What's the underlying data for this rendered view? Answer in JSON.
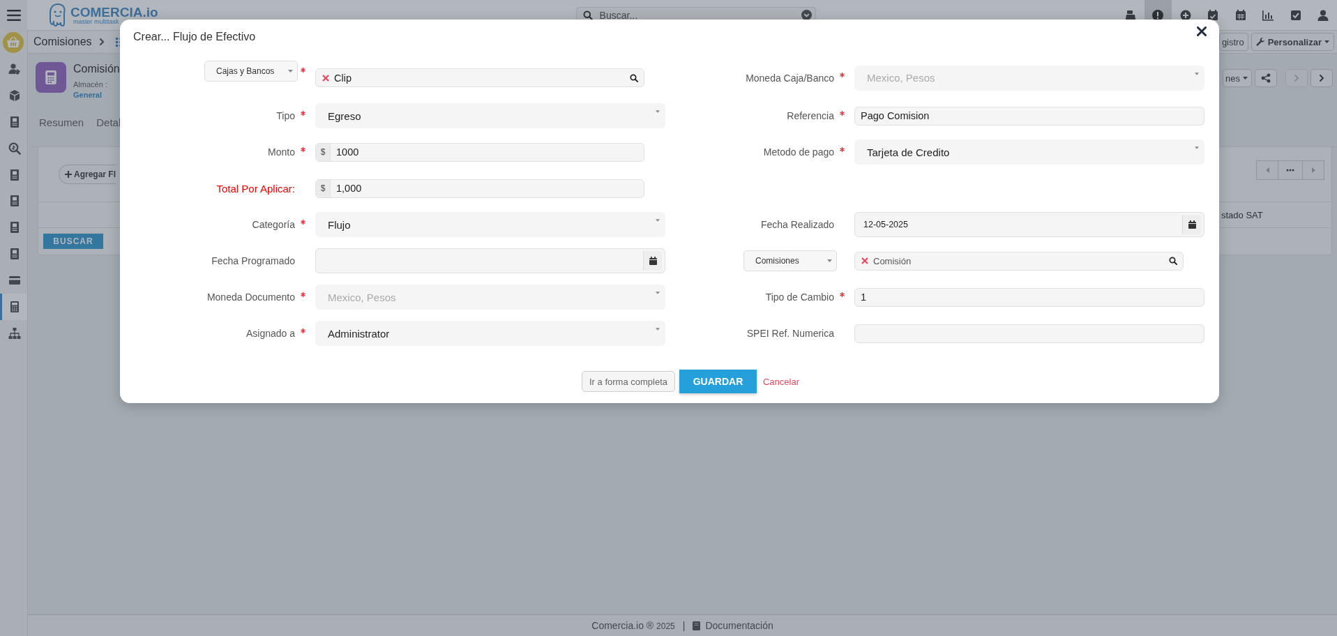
{
  "topbar": {
    "logo": {
      "name": "COMERCIA.io",
      "tagline": "master multitask"
    },
    "search": {
      "placeholder": "Buscar..."
    },
    "icons": [
      {
        "selected": false
      },
      {
        "selected": true
      },
      {
        "selected": false
      },
      {
        "selected": false
      },
      {
        "selected": false
      },
      {
        "selected": false
      },
      {
        "selected": false
      },
      {
        "selected": false
      }
    ]
  },
  "breadcrumb": {
    "current": "Comisiones"
  },
  "sidebar": {
    "items": [
      {
        "selected": false
      },
      {
        "selected": false
      },
      {
        "selected": false
      },
      {
        "selected": false
      },
      {
        "selected": false
      },
      {
        "selected": false
      },
      {
        "selected": false
      },
      {
        "selected": false
      },
      {
        "selected": false
      },
      {
        "selected": true
      },
      {
        "selected": false
      }
    ]
  },
  "record": {
    "title": "Comisión",
    "warehouse_label": "Almacén :",
    "warehouse": "General"
  },
  "header_buttons": {
    "register": "gistro",
    "customize": "Personalizar",
    "actions": "nes"
  },
  "tabs": [
    {
      "label": "Resumen",
      "selected": false
    },
    {
      "label": "Detal",
      "selected": false
    }
  ],
  "list": {
    "add_button": "Agregar Fl",
    "column": "stado SAT",
    "search_button": "BUSCAR"
  },
  "modal": {
    "title": "Crear... Flujo de Efectivo",
    "left": [
      {
        "kind": "lookup",
        "selector": "Cajas y Bancos",
        "required": true,
        "value": "Clip"
      },
      {
        "kind": "select",
        "label": "Tipo",
        "required": true,
        "warning": false,
        "disabled": false,
        "value": "Egreso"
      },
      {
        "kind": "money",
        "label": "Monto",
        "required": true,
        "warning": false,
        "prefix": "$",
        "value": "1000"
      },
      {
        "kind": "money",
        "label": "Total Por Aplicar:",
        "required": false,
        "warning": true,
        "prefix": "$",
        "value": "1,000"
      },
      {
        "kind": "select",
        "label": "Categoría",
        "required": true,
        "warning": false,
        "disabled": false,
        "value": "Flujo"
      },
      {
        "kind": "date",
        "label": "Fecha Programado",
        "required": false,
        "warning": false
      },
      {
        "kind": "select",
        "label": "Moneda Documento",
        "required": true,
        "warning": false,
        "disabled": true,
        "value": "Mexico, Pesos"
      },
      {
        "kind": "select",
        "label": "Asignado a",
        "required": true,
        "warning": false,
        "disabled": false,
        "value": "Administrator"
      }
    ],
    "right": [
      {
        "kind": "select",
        "label": "Moneda Caja/Banco",
        "required": true,
        "warning": false,
        "disabled": true,
        "value": "Mexico, Pesos"
      },
      {
        "kind": "text",
        "label": "Referencia",
        "required": true,
        "warning": false,
        "value": "Pago Comision"
      },
      {
        "kind": "select",
        "label": "Metodo de pago",
        "required": true,
        "warning": false,
        "disabled": false,
        "value": "Tarjeta de Credito"
      },
      {
        "kind": "empty"
      },
      {
        "kind": "date",
        "label": "Fecha Realizado",
        "required": false,
        "warning": false,
        "value": "12-05-2025"
      },
      {
        "kind": "lookup",
        "selector": "Comisiones",
        "required": false,
        "value": "Comisión"
      },
      {
        "kind": "text",
        "label": "Tipo de Cambio",
        "required": true,
        "warning": false,
        "value": "1"
      },
      {
        "kind": "text",
        "label": "SPEI Ref. Numerica",
        "required": false,
        "warning": false
      }
    ],
    "buttons": {
      "full_form": "Ir a forma completa",
      "save": "GUARDAR",
      "cancel": "Cancelar"
    }
  },
  "footer": {
    "brand": "Comercia.io ®",
    "year": "2025",
    "separator": "|",
    "docs": "Documentación"
  }
}
